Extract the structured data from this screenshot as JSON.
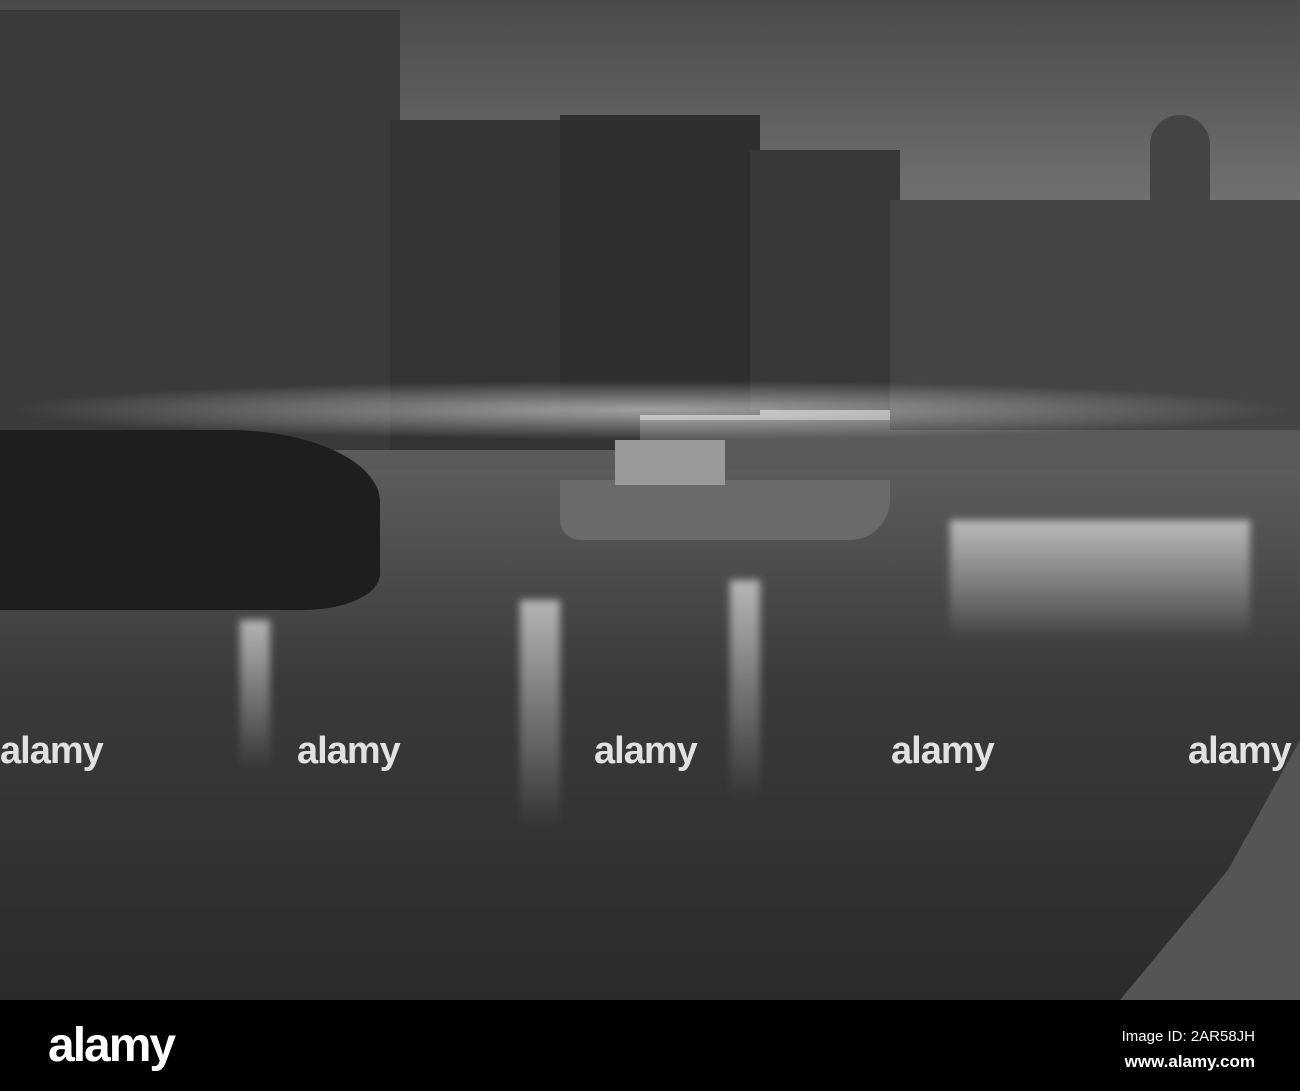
{
  "photo": {
    "watermark_text": "alamy"
  },
  "footer": {
    "logo": "alamy",
    "image_id": "Image ID: 2AR58JH",
    "url": "www.alamy.com"
  }
}
